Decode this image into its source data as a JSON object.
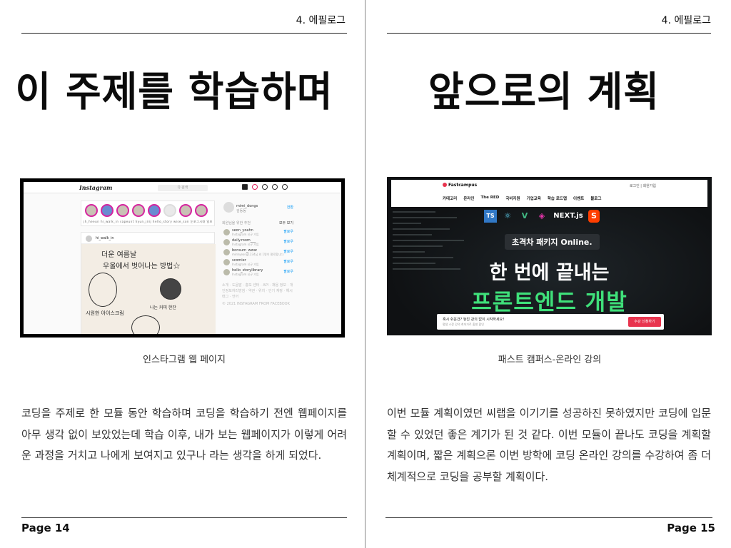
{
  "left_page": {
    "chapter": "4. 에필로그",
    "title": "이 주제를 학습하며",
    "caption": "인스타그램 웹 페이지",
    "body": "코딩을 주제로 한 모듈 동안 학습하며 코딩을 학습하기 전엔 웹페이지를 아무 생각 없이 보았었는데 학습 이후, 내가 보는 웹페이지가 이렇게 어려운 과정을 거치고 나에게 보여지고 있구나 라는 생각을 하게 되었다.",
    "page_number": "Page 14",
    "screenshot": {
      "logo": "Instagram",
      "search_placeholder": "Q 검색",
      "story_labels": "jh_heeun  hi_walk_in  sapeunt  hyun_jiiij  hello_story  wise_son  눈포그시대  일포",
      "post_user": "hi_walk_in",
      "sketch_text": [
        "더운 여름날",
        "우울에서 벗어나는 방법☆",
        "시원한 아이스크림",
        "나는 커피 한잔"
      ],
      "side_user": "mimi_dongs",
      "side_user_name": "김동동",
      "side_switch": "전환",
      "suggestions_title": "회원님을 위한 추천",
      "suggestions_all": "모두 보기",
      "suggestions": [
        {
          "name": "seon_yoahn",
          "sub": "Instagram 신규 가입",
          "action": "팔로우"
        },
        {
          "name": "daily.room___",
          "sub": "Instagram 신규 가입",
          "action": "팔로우"
        },
        {
          "name": "bonsum_www",
          "sub": "minhyeong1234님 외 1명이 팔로합니다",
          "action": "팔로우"
        },
        {
          "name": "scomier",
          "sub": "Instagram 신규 가입",
          "action": "팔로우"
        },
        {
          "name": "hello_storylibrary",
          "sub": "Instagram 신규 가입",
          "action": "팔로우"
        }
      ],
      "side_footer": "소개 · 도움말 · 홍보 센터 · API · 채용 정보 · 개인정보처리방침 · 약관 · 위치 · 인기 계정 · 해시태그 · 언어",
      "side_copyright": "© 2021 INSTAGRAM FROM FACEBOOK"
    }
  },
  "right_page": {
    "chapter": "4. 에필로그",
    "title": "앞으로의 계획",
    "caption": "패스트 캠퍼스-온라인 강의",
    "body": "이번 모듈 계획이였던 씨랩을 이기기를 성공하진 못하였지만 코딩에 입문할 수 있었던 좋은 계기가 된 것 같다. 이번 모듈이 끝나도 코딩을 계획할 계획이며, 짧은 계획으론 이번 방학에 코딩 온라인 강의를 수강하여 좀 더 체계적으로 코딩을 공부할 계획이다.",
    "page_number": "Page 15",
    "screenshot": {
      "logo": "Fastcampus",
      "login": "로그인 | 회원가입",
      "menu": [
        "카테고리",
        "온라인",
        "The RED",
        "국비지원",
        "기업교육",
        "학습 로드맵",
        "이벤트",
        "블로그"
      ],
      "tech_logos": [
        "TS",
        "⚛",
        "V",
        "◈",
        "NEXT.js",
        "S"
      ],
      "pill": "초격차 패키지 Online.",
      "headline1": "한 번에 끝내는",
      "headline2": "프론트엔드 개발",
      "bar_text": "혹시 쉬운건? 놓친 강의 없이 시작하세요!",
      "bar_sub": "평생 소장 강의 최저가로 출발 할인",
      "bar_button": "수강 신청하기"
    }
  },
  "colors": {
    "fc_red": "#e8344e",
    "fc_green": "#3fe07a",
    "ig_blue": "#0095f6"
  }
}
